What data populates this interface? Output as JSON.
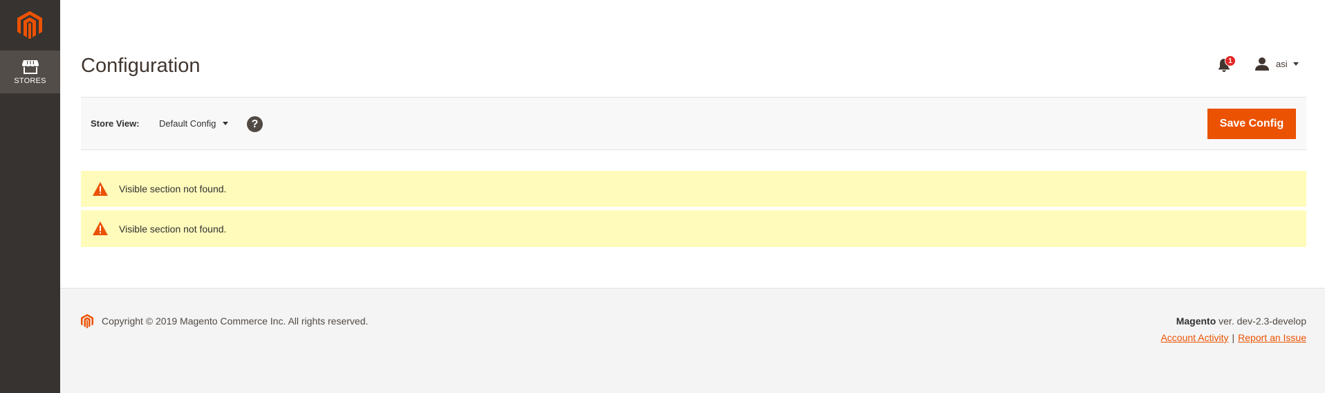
{
  "sidebar": {
    "logo_icon": "magento-logo-icon",
    "items": [
      {
        "label": "STORES",
        "icon": "store-icon"
      }
    ]
  },
  "header": {
    "title": "Configuration",
    "notifications": {
      "icon": "bell-icon",
      "count": "1"
    },
    "user": {
      "icon": "user-icon",
      "name": "asi"
    }
  },
  "toolbar": {
    "store_view_label": "Store View:",
    "store_view_value": "Default Config",
    "help_icon": "question-icon",
    "help_glyph": "?",
    "save_label": "Save Config"
  },
  "messages": [
    {
      "type": "warning",
      "text": "Visible section not found."
    },
    {
      "type": "warning",
      "text": "Visible section not found."
    }
  ],
  "footer": {
    "copyright": "Copyright © 2019 Magento Commerce Inc. All rights reserved.",
    "product": "Magento",
    "version": " ver. dev-2.3-develop",
    "links": [
      "Account Activity",
      "Report an Issue"
    ],
    "separator": "|"
  },
  "colors": {
    "accent": "#eb5202",
    "sidebar": "#373330",
    "warning_bg": "#fffbbb",
    "badge": "#e22626"
  }
}
